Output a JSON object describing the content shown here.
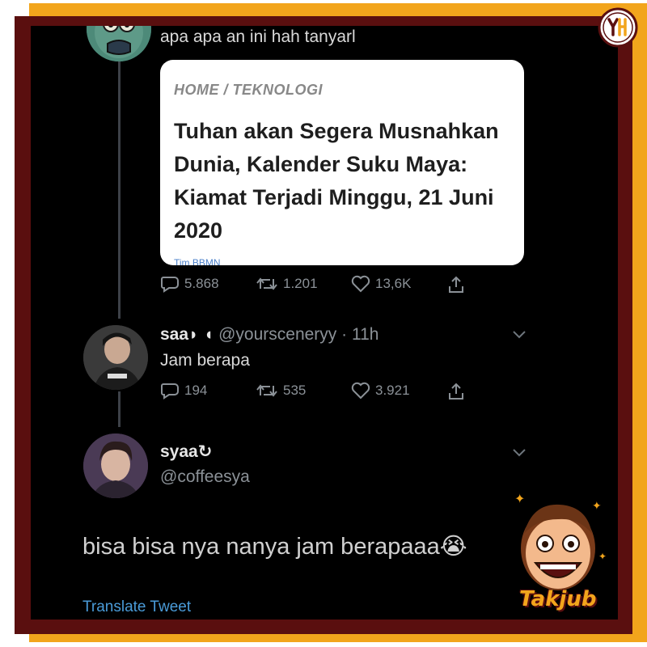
{
  "quoted_tweet": {
    "text": "apa apa an ini hah tanyarl",
    "card": {
      "breadcrumb": "HOME / TEKNOLOGI",
      "headline": "Tuhan akan Segera Musnahkan Dunia, Kalender Suku Maya: Kiamat Terjadi Minggu, 21 Juni 2020",
      "cut_text": "Tim BBMN"
    },
    "actions": {
      "replies": "5.868",
      "retweets": "1.201",
      "likes": "13,6K"
    }
  },
  "reply_1": {
    "display_name": "saa",
    "display_name_suffix": "◗ ◖",
    "handle": "@yoursceneryy",
    "separator": "·",
    "time": "11h",
    "text": "Jam berapa",
    "actions": {
      "replies": "194",
      "retweets": "535",
      "likes": "3.921"
    }
  },
  "main_tweet": {
    "display_name": "syaa",
    "name_icon": "↻",
    "handle": "@coffeesya",
    "text": "bisa bisa nya nanya jam berapaaa",
    "emoji": "😭",
    "translate_label": "Translate Tweet"
  },
  "sticker": {
    "label": "Takjub"
  },
  "icons": [
    "reply-icon",
    "retweet-icon",
    "like-icon",
    "share-icon",
    "chevron-down-icon"
  ],
  "colors": {
    "background": "#000000",
    "frame_maroon": "#5a0f0f",
    "frame_yellow": "#f2a51c",
    "link_blue": "#4a9bd8",
    "muted": "#8b9197"
  }
}
